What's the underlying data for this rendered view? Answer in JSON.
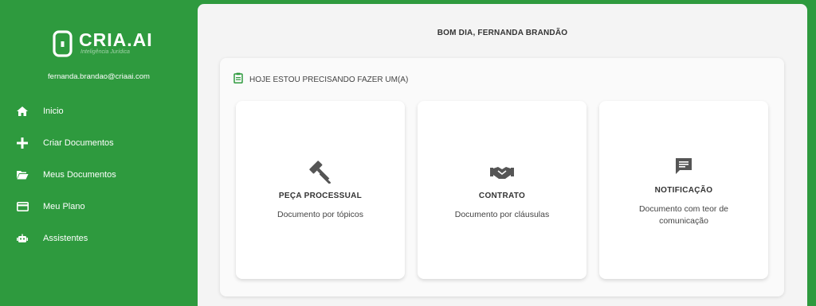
{
  "brand": {
    "name": "CRIA.AI",
    "tagline": "Inteligência Jurídica"
  },
  "user": {
    "email": "fernanda.brandao@criaai.com"
  },
  "sidebar": {
    "items": [
      {
        "label": "Inicio",
        "icon": "home-icon"
      },
      {
        "label": "Criar Documentos",
        "icon": "plus-icon"
      },
      {
        "label": "Meus Documentos",
        "icon": "folder-open-icon"
      },
      {
        "label": "Meu Plano",
        "icon": "credit-card-icon"
      },
      {
        "label": "Assistentes",
        "icon": "robot-icon"
      }
    ]
  },
  "main": {
    "greeting": "BOM DIA, FERNANDA BRANDÃO",
    "panel_title": "HOJE ESTOU PRECISANDO FAZER UM(A)",
    "cards": [
      {
        "title": "PEÇA PROCESSUAL",
        "description": "Documento por tópicos",
        "icon": "gavel-icon"
      },
      {
        "title": "CONTRATO",
        "description": "Documento por cláusulas",
        "icon": "handshake-icon"
      },
      {
        "title": "NOTIFICAÇÃO",
        "description": "Documento com teor de comunicação",
        "icon": "message-icon"
      }
    ]
  },
  "colors": {
    "brand_green": "#2e9a3e",
    "icon_gray": "#555555"
  }
}
